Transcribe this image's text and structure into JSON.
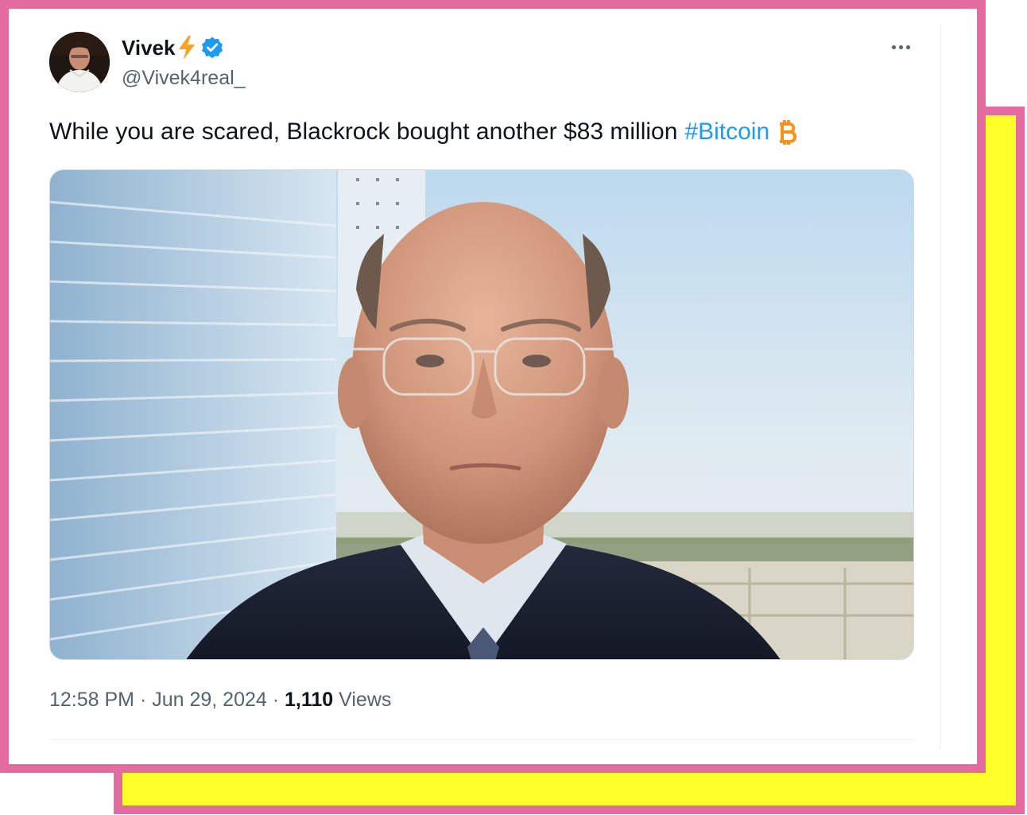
{
  "tweet": {
    "author": {
      "display_name": "Vivek",
      "handle": "@Vivek4real_",
      "name_emoji_icon": "lightning-bolt-icon",
      "badge_icon": "verified-badge-icon"
    },
    "text": "While you are scared, Blackrock bought another $83 million",
    "hashtag": "#Bitcoin",
    "trailing_icon": "bitcoin-icon",
    "timestamp": "12:58 PM · Jun 29, 2024",
    "separator": " · ",
    "views_count": "1,110",
    "views_label": "Views",
    "more_icon": "more-options-icon"
  },
  "colors": {
    "frame_pink": "#e46b9f",
    "back_card_yellow": "#ffff2a",
    "text_primary": "#0f1419",
    "text_secondary": "#536471",
    "link_blue": "#1d9bf0",
    "verified_blue": "#1d9bf0",
    "bolt_orange": "#f7a32b",
    "bitcoin_orange": "#f7931a"
  }
}
